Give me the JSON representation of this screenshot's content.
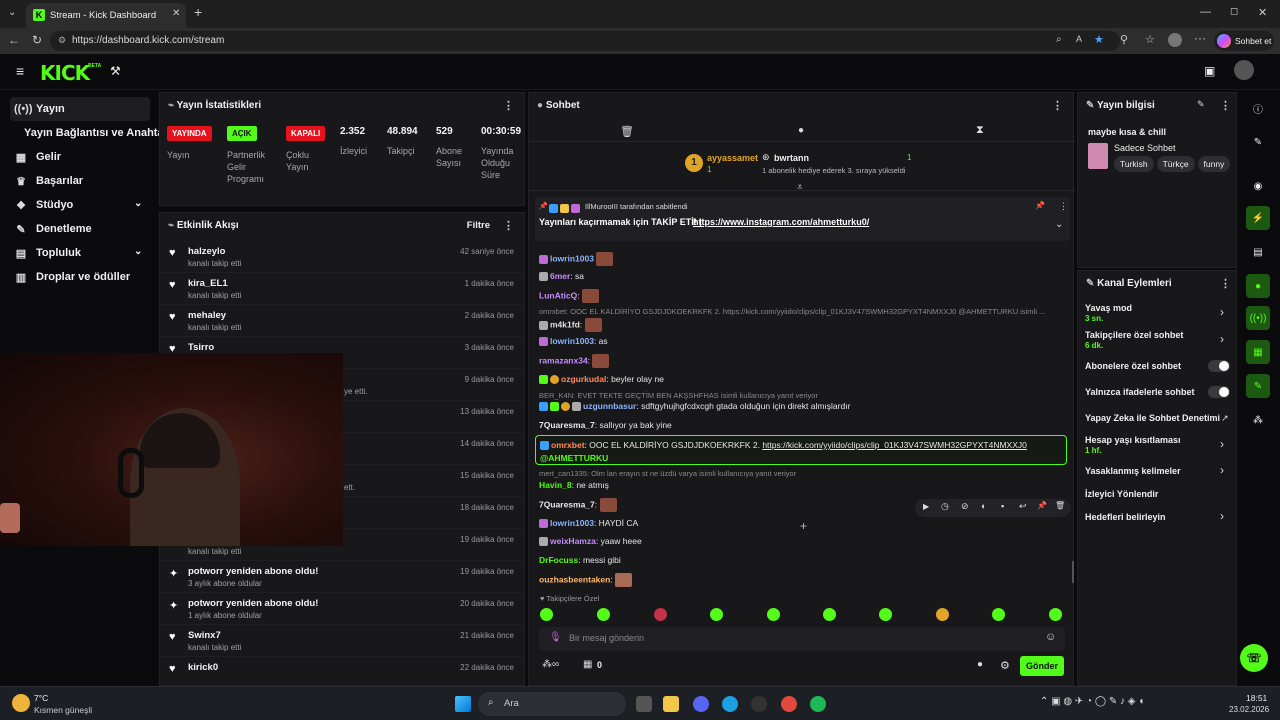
{
  "browser": {
    "tab_title": "Stream - Kick Dashboard",
    "url": "https://dashboard.kick.com/stream",
    "profile_label": "Sohbet et"
  },
  "header": {
    "logo": "KICK",
    "beta": "BETA"
  },
  "sidebar": {
    "items": [
      {
        "label": "Yayın",
        "icon": "broadcast-icon"
      },
      {
        "label": "Yayın Bağlantısı ve Anahtarı",
        "icon": ""
      },
      {
        "label": "Gelir",
        "icon": "dollar-icon"
      },
      {
        "label": "Başarılar",
        "icon": "trophy-icon"
      },
      {
        "label": "Stüdyo",
        "icon": "studio-icon"
      },
      {
        "label": "Denetleme",
        "icon": "wrench-icon"
      },
      {
        "label": "Topluluk",
        "icon": "community-icon"
      },
      {
        "label": "Droplar ve ödüller",
        "icon": "gift-icon"
      }
    ]
  },
  "stats": {
    "title": "Yayın İstatistikleri",
    "badge_live": "YAYINDA",
    "badge_open": "AÇIK",
    "badge_closed": "KAPALI",
    "lbl_stream": "Yayın",
    "lbl_partner": "Partnerlik Gelir Programı",
    "lbl_multi": "Çoklu Yayın",
    "viewers": "2.352",
    "lbl_viewers": "İzleyici",
    "followers": "48.894",
    "lbl_followers": "Takipçi",
    "subs": "529",
    "lbl_subs": "Abone Sayısı",
    "uptime": "00:30:59",
    "lbl_uptime": "Yayında Olduğu Süre"
  },
  "activity": {
    "title": "Etkinlik Akışı",
    "filter": "Filtre",
    "rows": [
      {
        "name": "halzeylo",
        "sub": "kanalı takip etti",
        "time": "42 saniye önce"
      },
      {
        "name": "kira_EL1",
        "sub": "kanalı takip etti",
        "time": "1 dakika önce"
      },
      {
        "name": "mehaley",
        "sub": "kanalı takip etti",
        "time": "2 dakika önce"
      },
      {
        "name": "Tsirro",
        "sub": "",
        "time": "3 dakika önce"
      },
      {
        "name": "",
        "sub": "ye etti.",
        "time": "9 dakika önce"
      },
      {
        "name": "",
        "sub": "",
        "time": "13 dakika önce"
      },
      {
        "name": "",
        "sub": "",
        "time": "14 dakika önce"
      },
      {
        "name": "",
        "sub": "ett.",
        "time": "15 dakika önce"
      },
      {
        "name": "",
        "sub": "",
        "time": "18 dakika önce"
      },
      {
        "name": "",
        "sub": "kanalı takip etti",
        "time": "19 dakika önce"
      },
      {
        "name": "potworr yeniden abone oldu!",
        "sub": "3 aylık abone oldular",
        "time": "19 dakika önce"
      },
      {
        "name": "potworr yeniden abone oldu!",
        "sub": "1 aylık abone oldular",
        "time": "20 dakika önce"
      },
      {
        "name": "Swinx7",
        "sub": "kanalı takip etti",
        "time": "21 dakika önce"
      },
      {
        "name": "kirick0",
        "sub": "",
        "time": "22 dakika önce"
      }
    ]
  },
  "chat": {
    "title": "Sohbet",
    "gifter1_name": "ayyassamet",
    "gifter1_count": "1",
    "gifter2_name": "bwrtann",
    "gifter2_count": "1",
    "gift_note": "1 abonelik hediye ederek 3. sıraya yükseldi",
    "pinned_by": "IllMurooIII tarafından sabitlendi",
    "pinned_text": "Yayınları kaçırmamak için TAKİP ETİ! |",
    "pinned_link": "https://www.instagram.com/ahmetturku0/",
    "messages": [
      {
        "user": "lowrin1003",
        "text": "",
        "color": "#8ab4ff"
      },
      {
        "user": "6mer",
        "text": ": sa",
        "color": "#c78cff"
      },
      {
        "user": "LunAticQ",
        "text": ":",
        "color": "#c78cff"
      },
      {
        "user": "m4k1fd",
        "text": ":",
        "color": "#e0e0e0"
      },
      {
        "user": "lowrin1003",
        "text": ": as",
        "color": "#8ab4ff"
      },
      {
        "user": "ramazanx34",
        "text": ":",
        "color": "#c78cff"
      },
      {
        "user": "ozgurkudal",
        "text": ": beyler olay ne",
        "color": "#ff8a5c"
      },
      {
        "user": "uzgunnbasur",
        "text": ": sdftgyhujhgfcdxcgh gtada olduğun için direkt almışlardır",
        "color": "#8ab4ff"
      },
      {
        "user": "7Quaresma_7",
        "text": ": sallıyor ya bak yine",
        "color": "#e8e8e8"
      },
      {
        "user": "omrxbet",
        "text": ": OOC EL KALDİRİYO GSJDJDKOEKRKFK 2.",
        "color": "#ff8a5c"
      },
      {
        "user": "Havin_8",
        "text": ": ne atmış",
        "color": "#53fc18"
      },
      {
        "user": "7Quaresma_7",
        "text": ":",
        "color": "#e8e8e8"
      },
      {
        "user": "lowrin1003",
        "text": ": HAYDİ CA",
        "color": "#8ab4ff"
      },
      {
        "user": "weixHamza",
        "text": ": yaaw heee",
        "color": "#c78cff"
      },
      {
        "user": "DrFocuss",
        "text": ": messi gibi",
        "color": "#53fc18"
      },
      {
        "user": "ouzhasbeentaken",
        "text": ":",
        "color": "#ffb86b"
      }
    ],
    "reply1": "omrxbet: OOC EL KALDİRİYO GSJDJDKOEKRKFK 2. https://kick.com/yyiido/clips/clip_01KJ3V47SWMH32GPYXT4NMXXJ0 @AHMETTURKU isimli ...",
    "reply2": "BER_K4N: EVET TEKTE GEÇTİM BEN AKŞSHFHAS isimli kullanıcıya yanıt veriyor",
    "reply3": "mert_can1335: Olm lan erayın st ne üzdü varya isimli kullanıcıya yanıt veriyor",
    "hl_link": "https://kick.com/yyiido/clips/clip_01KJ3V47SWMH32GPYXT4NMXXJ0",
    "hl_mention": "@AHMETTURKU",
    "followers_only": "Takipçilere Özel",
    "input_placeholder": "Bir mesaj gönderin",
    "send": "Gönder",
    "count": "0"
  },
  "info": {
    "title": "Yayın bilgisi",
    "stream_title": "maybe kısa & chill",
    "category": "Sadece Sohbet",
    "tags": [
      "Turkish",
      "Türkçe",
      "funny"
    ]
  },
  "actions": {
    "title": "Kanal Eylemleri",
    "slow": "Yavaş mod",
    "slow_val": "3 sn.",
    "followers_chat": "Takipçilere özel sohbet",
    "followers_val": "6 dk.",
    "subs_chat": "Abonelere özel sohbet",
    "emote_chat": "Yalnızca ifadelerle sohbet",
    "ai_mod": "Yapay Zeka ile Sohbet Denetimi",
    "age": "Hesap yaşı kısıtlaması",
    "age_val": "1 hf.",
    "banned": "Yasaklanmış kelimeler",
    "redirect": "İzleyici Yönlendir",
    "goals": "Hedefleri belirleyin"
  },
  "taskbar": {
    "temp": "7°C",
    "weather": "Kısmen güneşli",
    "search": "Ara",
    "time": "18:51",
    "date": "23.02.2026"
  },
  "colors": {
    "brand": "#53fc18",
    "live": "#e5121d",
    "panel": "#18181b"
  }
}
